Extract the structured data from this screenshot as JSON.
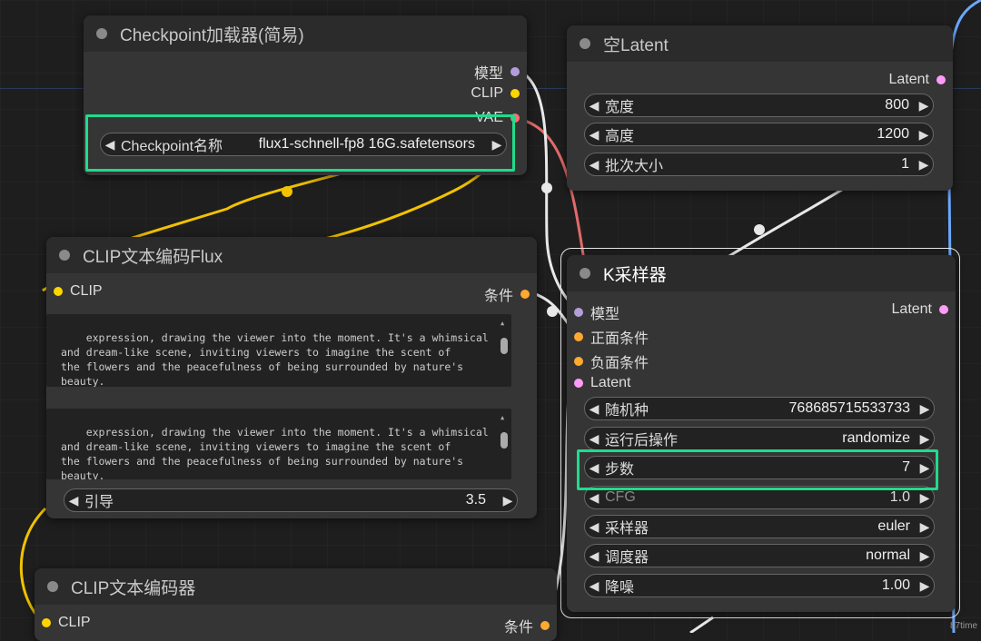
{
  "colors": {
    "highlight": "#1fdc8b",
    "model": "#b39ddb",
    "clip": "#ffd500",
    "vae": "#ff6e6e",
    "latent": "#ff9cf9",
    "conditioning": "#ffa931"
  },
  "checkpoint_node": {
    "title": "Checkpoint加载器(简易)",
    "outputs": [
      "模型",
      "CLIP",
      "VAE"
    ],
    "widget": {
      "label": "Checkpoint名称",
      "value": "flux1-schnell-fp8 16G.safetensors"
    }
  },
  "empty_latent_node": {
    "title": "空Latent",
    "output": "Latent",
    "widgets": [
      {
        "label": "宽度",
        "value": "800"
      },
      {
        "label": "高度",
        "value": "1200"
      },
      {
        "label": "批次大小",
        "value": "1"
      }
    ]
  },
  "clip_flux_node": {
    "title": "CLIP文本编码Flux",
    "input": "CLIP",
    "output": "条件",
    "text1": "expression, drawing the viewer into the moment. It's a whimsical\nand dream-like scene, inviting viewers to imagine the scent of\nthe flowers and the peacefulness of being surrounded by nature's\nbeauty.",
    "text2": "expression, drawing the viewer into the moment. It's a whimsical\nand dream-like scene, inviting viewers to imagine the scent of\nthe flowers and the peacefulness of being surrounded by nature's\nbeauty.",
    "widget": {
      "label": "引导",
      "value": "3.5"
    }
  },
  "ksampler_node": {
    "title": "K采样器",
    "inputs": [
      "模型",
      "正面条件",
      "负面条件",
      "Latent"
    ],
    "output": "Latent",
    "widgets": [
      {
        "label": "随机种",
        "value": "768685715533733"
      },
      {
        "label": "运行后操作",
        "value": "randomize"
      },
      {
        "label": "步数",
        "value": "7"
      },
      {
        "label": "CFG",
        "value": "1.0"
      },
      {
        "label": "采样器",
        "value": "euler"
      },
      {
        "label": "调度器",
        "value": "normal"
      },
      {
        "label": "降噪",
        "value": "1.00"
      }
    ]
  },
  "clip_encoder_node": {
    "title": "CLIP文本编码器",
    "input": "CLIP",
    "output": "条件"
  },
  "watermark": "87time"
}
